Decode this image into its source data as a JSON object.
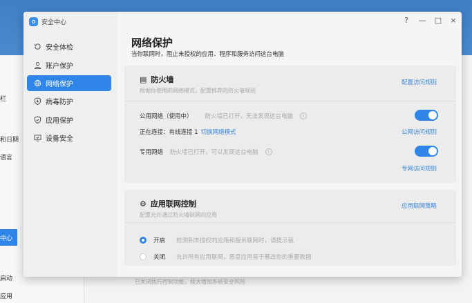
{
  "background": {
    "items": [
      "栏",
      "和日期",
      "语言",
      "中心",
      "启动",
      "应用"
    ],
    "bottom_text": "已关闭执行控制功能，极大增加系统安全风险"
  },
  "window": {
    "title": "安全中心",
    "controls": [
      "?",
      "—",
      "□",
      "×"
    ]
  },
  "sidebar": {
    "items": [
      {
        "label": "安全体检",
        "icon": "refresh-icon"
      },
      {
        "label": "账户保护",
        "icon": "user-icon"
      },
      {
        "label": "网络保护",
        "icon": "globe-icon",
        "selected": true
      },
      {
        "label": "病毒防护",
        "icon": "shield-plus-icon"
      },
      {
        "label": "应用保护",
        "icon": "shield-check-icon"
      },
      {
        "label": "设备安全",
        "icon": "monitor-icon"
      }
    ]
  },
  "main": {
    "title": "网络保护",
    "subtitle": "当你联网时，阻止未授权的应用、程序和服务访问这台电脑",
    "firewall": {
      "title": "防火墙",
      "desc": "根据你使用的网络模式，配置推荐的防火墙规则",
      "link": "配置访问规则",
      "public_label": "公用网络（使用中）",
      "public_status": "防火墙已打开，无法发现这台电脑",
      "public_on": true,
      "connecting": "正在连接：有线连接 1",
      "switch_mode": "切换网络模式",
      "public_link": "公网访问规则",
      "private_label": "专用网络",
      "private_status": "防火墙已打开，可以发现这台电脑",
      "private_on": true,
      "private_link": "专网访问规则"
    },
    "appctl": {
      "title": "应用联网控制",
      "desc": "配置允许通过防火墙联网的应用",
      "link": "应用联网策略",
      "on_label": "开启",
      "on_desc": "检测到未授权的应用和服务联网时，请提示我",
      "off_label": "关闭",
      "off_desc": "允许所有应用联网，恶意应用易于篡改你的重要数据",
      "selected": "开启"
    }
  },
  "colors": {
    "accent": "#2f86e8",
    "link": "#3a86d8"
  }
}
